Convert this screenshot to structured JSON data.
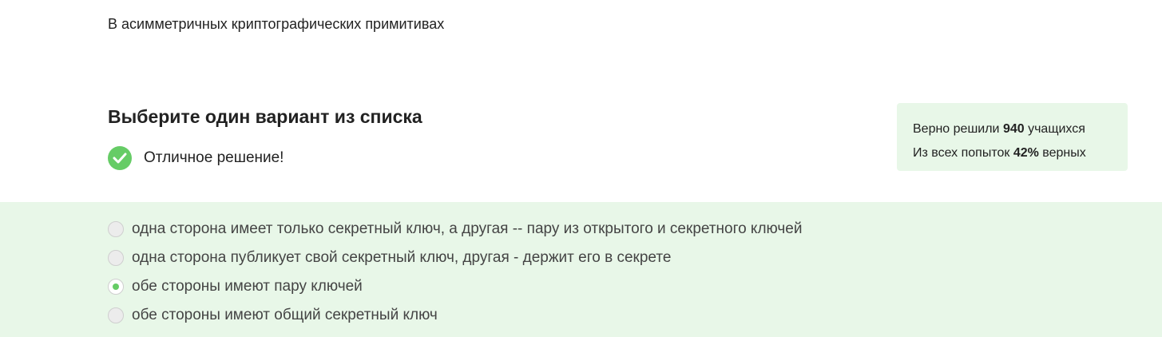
{
  "question": {
    "text": "В асимметричных криптографических примитивах"
  },
  "task": {
    "heading": "Выберите один вариант из списка"
  },
  "feedback": {
    "icon": "check-circle-icon",
    "text": "Отличное решение!",
    "color": "#66cc66"
  },
  "stats": {
    "solved_prefix": "Верно решили ",
    "solved_count": "940",
    "solved_suffix": " учащихся",
    "attempts_prefix": "Из всех попыток ",
    "attempts_percent": "42%",
    "attempts_suffix": " верных"
  },
  "options": [
    {
      "label": "одна сторона имеет только секретный ключ, а другая -- пару из открытого и секретного ключей",
      "selected": false
    },
    {
      "label": "одна сторона публикует свой секретный ключ, другая - держит его в секрете",
      "selected": false
    },
    {
      "label": "обе стороны имеют пару ключей",
      "selected": true
    },
    {
      "label": "обе стороны имеют общий секретный ключ",
      "selected": false
    }
  ],
  "colors": {
    "accent": "#66cc66",
    "options_background": "#e8f7e8"
  }
}
